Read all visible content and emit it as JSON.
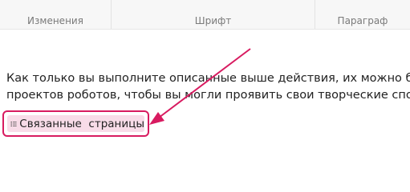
{
  "ribbon": {
    "groups": [
      {
        "label": "Изменения"
      },
      {
        "label": "Шрифт"
      },
      {
        "label": "Параграф"
      }
    ]
  },
  "content": {
    "lines": [
      "Как только вы выполните описанные выше действия, их можно буде",
      "проектов роботов, чтобы вы могли проявить свои творческие спосо"
    ]
  },
  "related_pages": {
    "label": "Связанные  страницы",
    "icon": "list-icon"
  },
  "annotation": {
    "arrow_color": "#d81b60",
    "highlight_color": "#f8dce8"
  }
}
